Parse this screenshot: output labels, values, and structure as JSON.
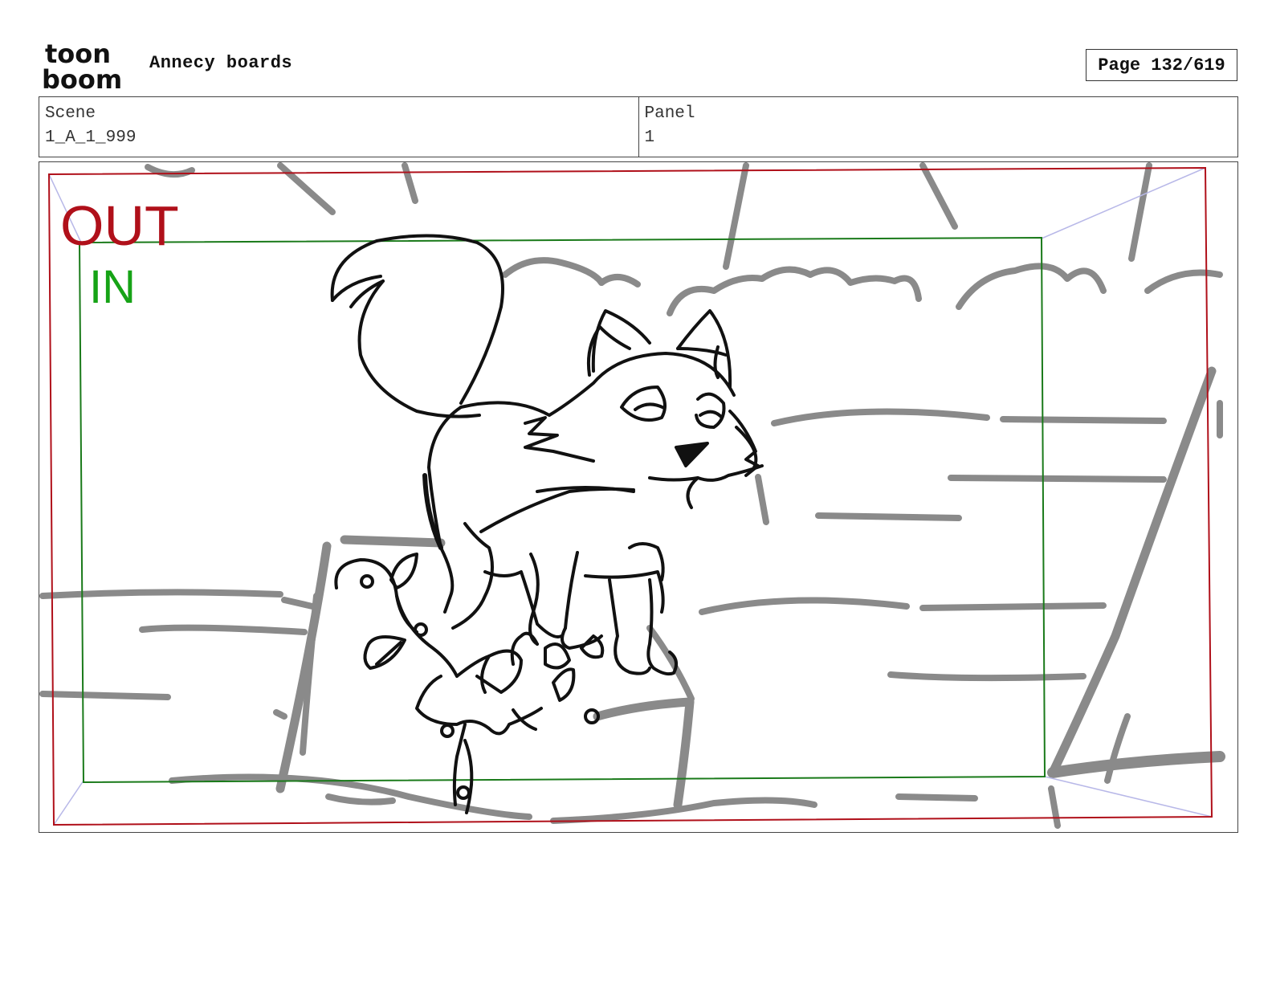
{
  "header": {
    "logo": {
      "line1": "toon",
      "line2": "boom"
    },
    "project_title": "Annecy boards",
    "page_indicator": "Page 132/619"
  },
  "info": {
    "scene_label": "Scene",
    "scene_value": "1_A_1_999",
    "panel_label": "Panel",
    "panel_value": "1"
  },
  "panel": {
    "out_label": "OUT",
    "in_label": "IN",
    "colors": {
      "out_frame": "#b0101a",
      "in_frame": "#1a7a1a",
      "background_lines": "#8a8a8a",
      "character_lines": "#111111"
    },
    "content": [
      "fox-sketch",
      "vine-with-flowers",
      "rock-ledge",
      "clouds",
      "water-lines"
    ]
  }
}
